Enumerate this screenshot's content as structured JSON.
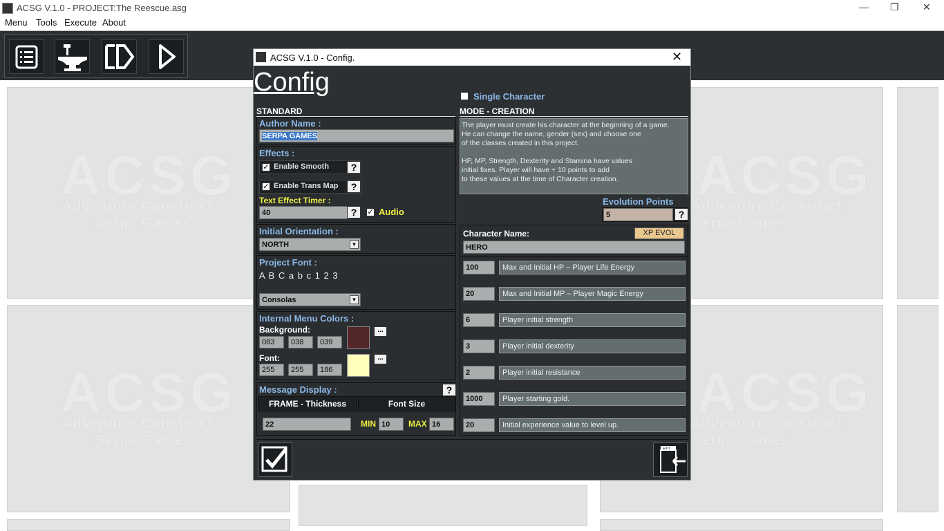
{
  "window": {
    "title": "ACSG V.1.0 - PROJECT:The Reescue.asg",
    "minimize": "—",
    "restore": "❐",
    "close": "✕"
  },
  "menu": {
    "items": [
      "Menu",
      "Tools",
      "Execute",
      "About"
    ]
  },
  "toolbar": {
    "buttons": [
      "list-icon",
      "anvil-icon",
      "exit-door-icon",
      "play-icon"
    ]
  },
  "watermark": {
    "logo": "ACSG",
    "line1": "Adventure Construct",
    "line2": "Serpa Games"
  },
  "dialog": {
    "title": "ACSG V.1.0 - Config.",
    "close": "✕",
    "heading": "Config",
    "standard_label": "STANDARD",
    "author": {
      "label": "Author Name :",
      "value": "SERPA GAMES"
    },
    "effects": {
      "label": "Effects :",
      "smooth": "Enable Smooth",
      "smooth_checked": true,
      "trans": "Enable Trans Map",
      "trans_checked": true,
      "timer_label": "Text Effect Timer :",
      "timer_value": "40",
      "audio": "Audio",
      "audio_checked": true
    },
    "help": "?",
    "orientation": {
      "label": "Initial Orientation :",
      "value": "NORTH"
    },
    "font": {
      "label": "Project Font :",
      "sample": "A B C a b c 1 2 3",
      "value": "Consolas"
    },
    "colors": {
      "label": "Internal Menu Colors :",
      "bg_label": "Background:",
      "bg": [
        "083",
        "038",
        "039"
      ],
      "bg_hex": "#532627",
      "font_label": "Font:",
      "font": [
        "255",
        "255",
        "186"
      ],
      "font_hex": "#ffffba",
      "more": "..."
    },
    "message": {
      "label": "Message Display :",
      "frame_label": "FRAME - Thickness",
      "size_label": "Font Size",
      "frame_value": "22",
      "min_label": "MIN",
      "min_value": "10",
      "max_label": "MAX",
      "max_value": "16"
    },
    "single_character": {
      "label": "Single Character",
      "checked": false
    },
    "mode_label": "MODE - CREATION",
    "mode_text": [
      "The player must create his character at the beginning of a game.",
      "He can change the name, gender (sex) and choose one",
      "of the classes created in this project.",
      "",
      "HP, MP, Strength, Dexterity and Stamina have values",
      "initial fixes. Player will have + 10 points to add",
      "to these values at the time of Character creation."
    ],
    "evolution": {
      "label": "Evolution Points",
      "value": "5"
    },
    "character": {
      "label": "Character Name:",
      "xp_button": "XP EVOL",
      "value": "HERO"
    },
    "stats": [
      {
        "value": "100",
        "desc": "Max and Initial HP – Player Life Energy"
      },
      {
        "value": "20",
        "desc": "Max and Initial MP – Player Magic Energy"
      },
      {
        "value": "6",
        "desc": "Player initial strength"
      },
      {
        "value": "3",
        "desc": "Player initial dexterity"
      },
      {
        "value": "2",
        "desc": "Player initial resistance"
      },
      {
        "value": "1000",
        "desc": "Player starting gold."
      },
      {
        "value": "20",
        "desc": "Initial experience value to level up."
      }
    ],
    "exit_label": "EXIT"
  }
}
